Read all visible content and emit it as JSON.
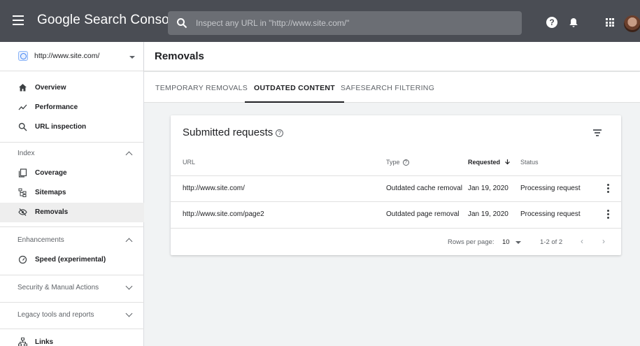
{
  "app": {
    "title": "Google Search Console",
    "search_placeholder": "Inspect any URL in \"http://www.site.com/\"",
    "help_glyph": "?"
  },
  "sidebar": {
    "property": "http://www.site.com/",
    "top_items": [
      {
        "label": "Overview",
        "icon": "home-icon"
      },
      {
        "label": "Performance",
        "icon": "trending-icon"
      },
      {
        "label": "URL inspection",
        "icon": "search-icon"
      }
    ],
    "sections": [
      {
        "label": "Index",
        "expanded": true,
        "items": [
          {
            "label": "Coverage",
            "icon": "coverage-icon"
          },
          {
            "label": "Sitemaps",
            "icon": "sitemap-icon"
          },
          {
            "label": "Removals",
            "icon": "removals-icon",
            "active": true
          }
        ]
      },
      {
        "label": "Enhancements",
        "expanded": true,
        "items": [
          {
            "label": "Speed (experimental)",
            "icon": "gauge-icon"
          }
        ]
      },
      {
        "label": "Security & Manual Actions",
        "expanded": false
      },
      {
        "label": "Legacy tools and reports",
        "expanded": false
      }
    ],
    "bottom_items": [
      {
        "label": "Links",
        "icon": "links-icon"
      }
    ]
  },
  "main": {
    "page_title": "Removals",
    "tabs": [
      {
        "label": "TEMPORARY REMOVALS",
        "active": false
      },
      {
        "label": "OUTDATED CONTENT",
        "active": true
      },
      {
        "label": "SAFESEARCH FILTERING",
        "active": false
      }
    ],
    "card": {
      "title": "Submitted requests",
      "help_glyph": "?",
      "columns": [
        "URL",
        "Type",
        "Requested",
        "Status"
      ],
      "rows": [
        {
          "url": "http://www.site.com/",
          "type": "Outdated cache removal",
          "requested": "Jan 19, 2020",
          "status": "Processing request"
        },
        {
          "url": "http://www.site.com/page2",
          "type": "Outdated page removal",
          "requested": "Jan 19, 2020",
          "status": "Processing request"
        }
      ],
      "footer": {
        "rows_per_page_label": "Rows per page:",
        "rows_per_page_value": "10",
        "range": "1-2 of 2",
        "prev": "‹",
        "next": "›"
      }
    }
  },
  "colors": {
    "topbar": "#4a4d54",
    "active_nav": "#eeeeee",
    "background": "#f1f3f4"
  }
}
